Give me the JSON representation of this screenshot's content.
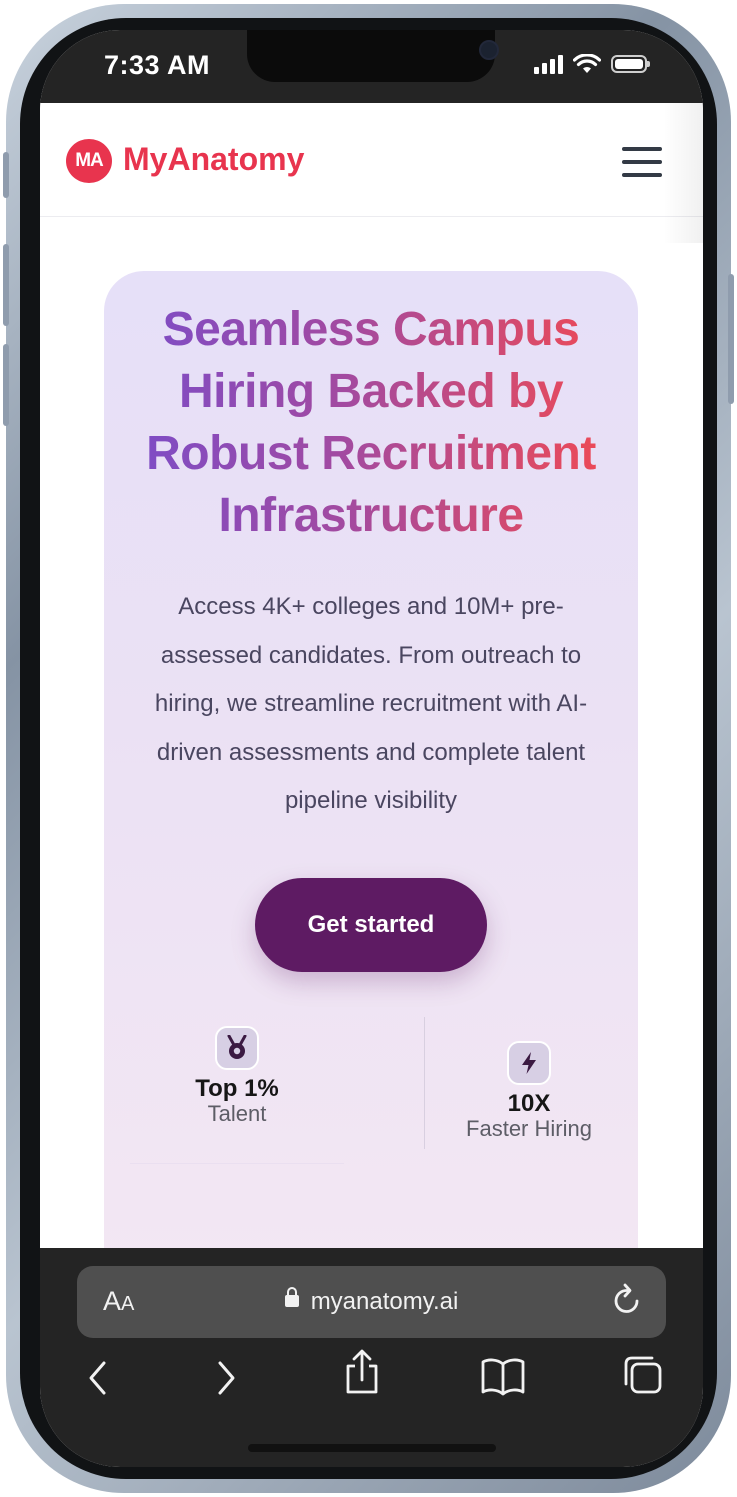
{
  "status_bar": {
    "time": "7:33 AM"
  },
  "header": {
    "logo_mark": "MA",
    "brand_name": "MyAnatomy"
  },
  "hero": {
    "title": "Seamless Campus Hiring Backed by Robust Recruitment Infrastructure",
    "description": "Access 4K+ colleges and 10M+ pre-assessed candidates. From outreach to hiring, we streamline recruitment with AI-driven assessments and complete talent pipeline visibility",
    "cta_label": "Get started",
    "stats": [
      {
        "icon": "medal-icon",
        "value": "Top 1%",
        "label": "Talent"
      },
      {
        "icon": "lightning-icon",
        "value": "10X",
        "label": "Faster Hiring"
      }
    ]
  },
  "browser": {
    "text_size_label": "AA",
    "url": "myanatomy.ai"
  },
  "colors": {
    "brand": "#e8344e",
    "cta": "#5e1b63",
    "title_gradient_start": "#7b4cc8",
    "title_gradient_end": "#f14a52"
  }
}
